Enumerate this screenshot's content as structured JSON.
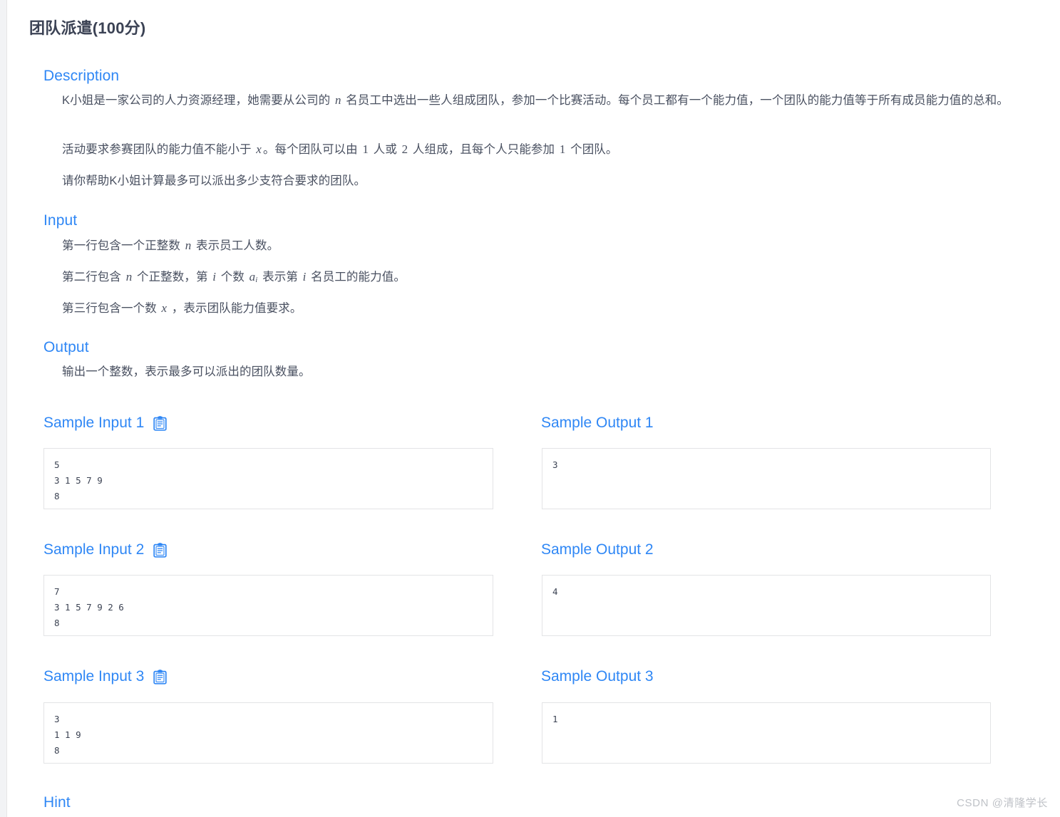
{
  "page": {
    "title": "团队派遣(100分)",
    "watermark": "CSDN @清隆学长"
  },
  "sections": {
    "description": {
      "heading": "Description",
      "paragraphs": [
        {
          "prefix": "K小姐是一家公司的人力资源经理，她需要从公司的 ",
          "var1": "n",
          "middle": " 名员工中选出一些人组成团队，参加一个比赛活动。每个员工都有一个能力值，一个团队的能力值等于所有成员能力值的总和。"
        },
        {
          "prefix": "活动要求参赛团队的能力值不能小于 ",
          "var1": "x",
          "middle": "。每个团队可以由 ",
          "num1": "1",
          "mid2": " 人或 ",
          "num2": "2",
          "mid3": " 人组成，且每个人只能参加 ",
          "num3": "1",
          "suffix": " 个团队。"
        },
        {
          "text": "请你帮助K小姐计算最多可以派出多少支符合要求的团队。"
        }
      ]
    },
    "input": {
      "heading": "Input",
      "lines": [
        {
          "prefix": "第一行包含一个正整数 ",
          "var1": "n",
          "suffix": " 表示员工人数。"
        },
        {
          "prefix": "第二行包含 ",
          "var1": "n",
          "mid1": " 个正整数，第 ",
          "var2": "i",
          "mid2": " 个数 ",
          "var3": "a",
          "var3sub": "i",
          "mid3": " 表示第 ",
          "var4": "i",
          "suffix": " 名员工的能力值。"
        },
        {
          "prefix": "第三行包含一个数 ",
          "var1": "x",
          "suffix": " ，表示团队能力值要求。"
        }
      ]
    },
    "output": {
      "heading": "Output",
      "text": "输出一个整数，表示最多可以派出的团队数量。"
    },
    "hint": {
      "heading": "Hint"
    }
  },
  "samples": [
    {
      "input_label": "Sample Input 1",
      "output_label": "Sample Output 1",
      "copy_icon": "clipboard-copy-icon",
      "input_text": "5\n3 1 5 7 9\n8",
      "output_text": "3"
    },
    {
      "input_label": "Sample Input 2",
      "output_label": "Sample Output 2",
      "copy_icon": "clipboard-copy-icon",
      "input_text": "7\n3 1 5 7 9 2 6\n8",
      "output_text": "4"
    },
    {
      "input_label": "Sample Input 3",
      "output_label": "Sample Output 3",
      "copy_icon": "clipboard-copy-icon",
      "input_text": "3\n1 1 9\n8",
      "output_text": "1"
    }
  ],
  "colors": {
    "heading_blue": "#2f87f5",
    "body_text": "#4a5161",
    "title_text": "#3b4254",
    "box_border": "#e3e4e6",
    "page_bg": "#f2f3f5",
    "watermark": "#bfc2c7"
  }
}
